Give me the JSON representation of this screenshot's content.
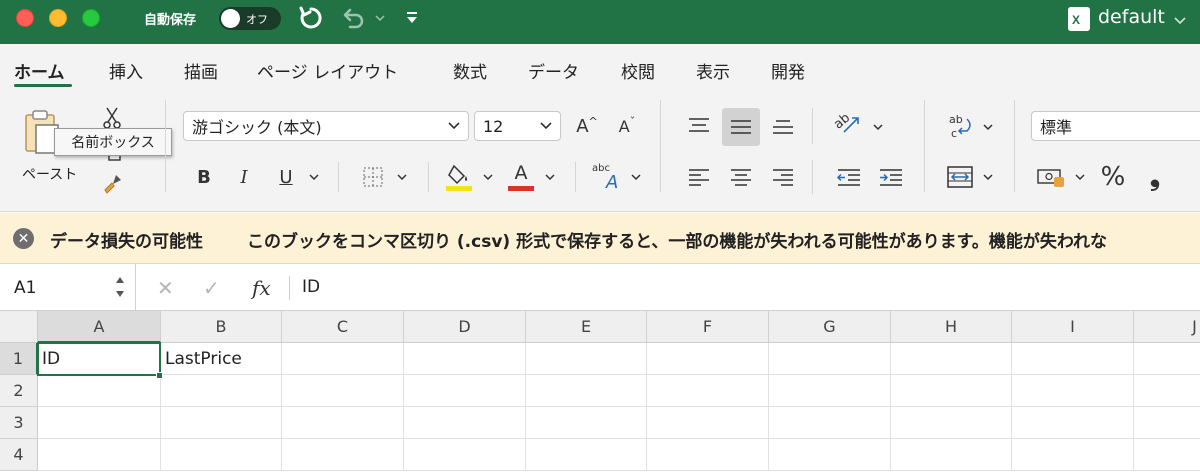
{
  "titlebar": {
    "autosave_label": "自動保存",
    "autosave_state": "オフ",
    "document_name": "default",
    "doc_icon_letter": "X"
  },
  "ribbon": {
    "tabs": [
      "ホーム",
      "挿入",
      "描画",
      "ページ レイアウト",
      "数式",
      "データ",
      "校閲",
      "表示",
      "開発"
    ],
    "active_tab": "ホーム",
    "paste_label": "ペースト",
    "tooltip": "名前ボックス",
    "font_name": "游ゴシック (本文)",
    "font_size": "12",
    "number_format": "標準",
    "increase_font": "A",
    "decrease_font": "A",
    "bold": "B",
    "italic": "I",
    "underline": "U",
    "font_color_letter": "A",
    "percent": "%",
    "comma": "❟",
    "abc_label": "abc",
    "ab_label": "ab",
    "fill_color": "#f5e11a",
    "font_color": "#d9332b"
  },
  "warning": {
    "title": "データ損失の可能性",
    "message": "このブックをコンマ区切り (.csv) 形式で保存すると、一部の機能が失われる可能性があります。機能が失われな"
  },
  "formula_bar": {
    "name_box": "A1",
    "fx": "fx",
    "value": "ID"
  },
  "sheet": {
    "columns": [
      "A",
      "B",
      "C",
      "D",
      "E",
      "F",
      "G",
      "H",
      "I",
      "J"
    ],
    "rows": [
      "1",
      "2",
      "3",
      "4"
    ],
    "cells": {
      "A1": "ID",
      "B1": "LastPrice"
    }
  },
  "colors": {
    "accent": "#217346"
  }
}
